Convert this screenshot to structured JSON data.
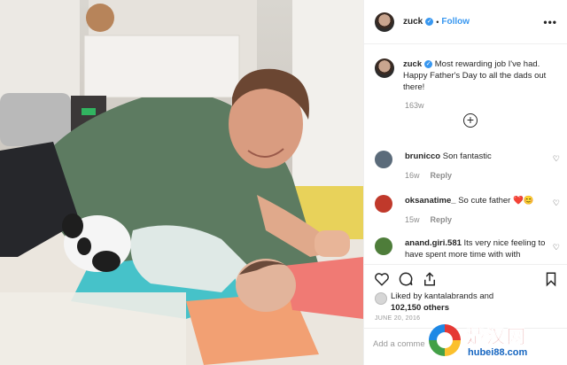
{
  "post": {
    "username": "zuck",
    "follow_label": "Follow",
    "more_label": "•••",
    "caption_text": "Most rewarding job I've had. Happy Father's Day to all the dads out there!",
    "caption_time": "163w",
    "likes_line1": "Liked by kantalabrands and",
    "likes_line2": "102,150 others",
    "date": "JUNE 20, 2016",
    "add_comment_placeholder": "Add a comme"
  },
  "comments": [
    {
      "user": "brunicco",
      "text": "Son fantastic",
      "time": "16w",
      "reply": "Reply",
      "avatar_color": "#5b6b7a"
    },
    {
      "user": "oksanatime_",
      "text": "So cute father ❤️😊",
      "time": "15w",
      "reply": "Reply",
      "avatar_color": "#c0392b"
    },
    {
      "user": "anand.giri.581",
      "text": "Its very nice feeling to have spent more time with with",
      "time": "",
      "reply": "",
      "avatar_color": "#4e7d3a"
    }
  ],
  "watermark": {
    "cn": "楚汉网",
    "url": "hubei88.com"
  },
  "colors": {
    "accent": "#3897f0",
    "text": "#262626",
    "muted": "#8e8e8e"
  },
  "icons": [
    "verified-badge-icon",
    "more-options-icon",
    "load-more-icon",
    "heart-icon",
    "comment-icon",
    "share-icon",
    "bookmark-icon"
  ]
}
